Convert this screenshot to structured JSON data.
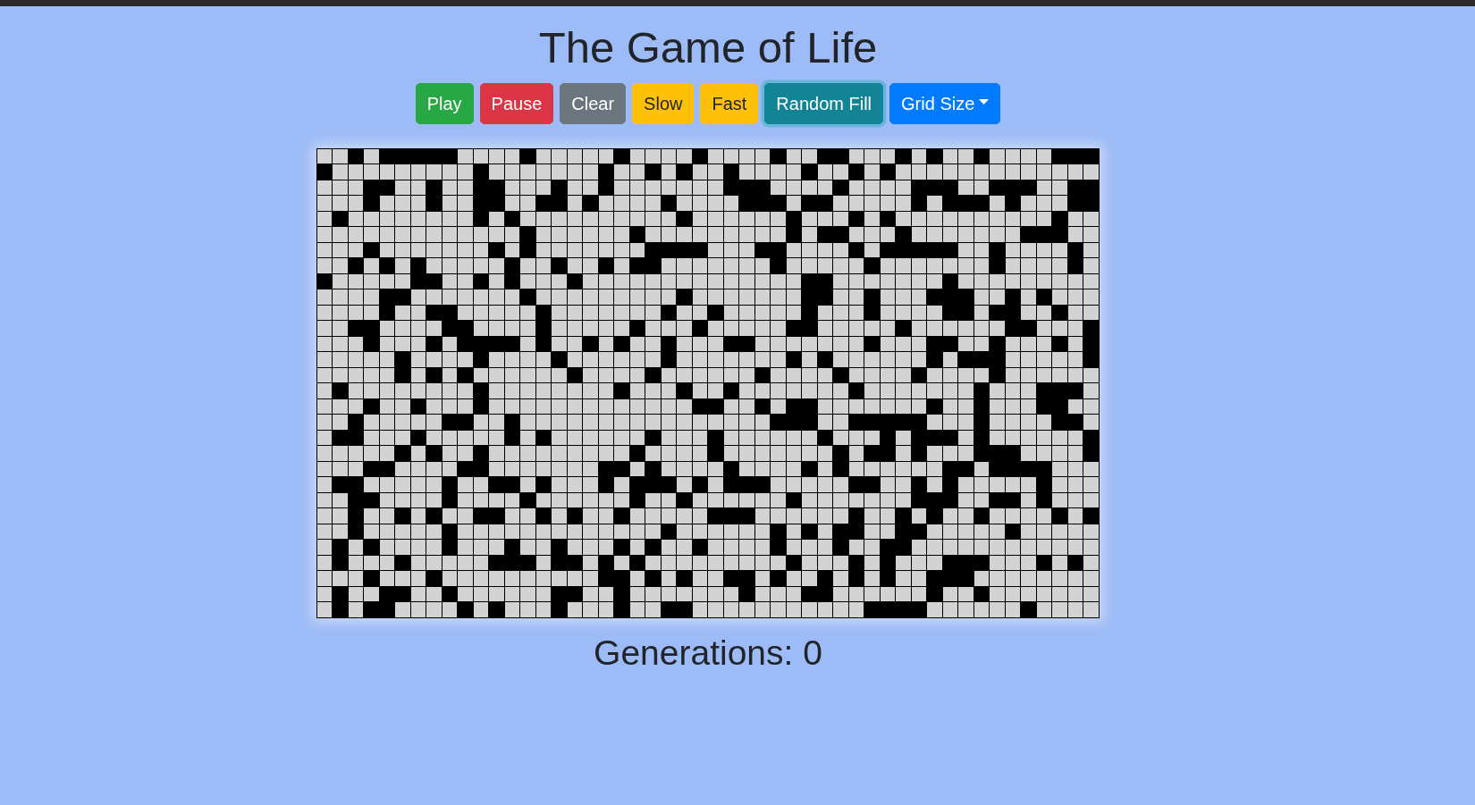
{
  "title": "The Game of Life",
  "buttons": [
    {
      "label": "Play",
      "kind": "button",
      "color": "#28a745",
      "focused": false
    },
    {
      "label": "Pause",
      "kind": "button",
      "color": "#dc3545",
      "focused": false
    },
    {
      "label": "Clear",
      "kind": "button",
      "color": "#6c757d",
      "focused": false
    },
    {
      "label": "Slow",
      "kind": "button",
      "color": "#ffc107",
      "focused": false
    },
    {
      "label": "Fast",
      "kind": "button",
      "color": "#ffc107",
      "focused": false
    },
    {
      "label": "Random Fill",
      "kind": "button",
      "color": "#138496",
      "focused": true
    },
    {
      "label": "Grid Size",
      "kind": "dropdown",
      "color": "#007bff",
      "focused": false
    }
  ],
  "board": {
    "rows": [
      [
        false,
        false,
        true,
        false,
        true,
        true,
        true,
        true,
        true,
        false,
        false,
        false,
        false,
        true,
        false,
        false,
        false,
        false,
        false,
        true,
        false,
        false,
        false,
        false,
        true,
        false,
        false,
        false,
        false,
        true,
        false,
        false,
        true,
        true,
        false,
        false,
        false,
        true,
        false,
        true,
        false,
        false,
        true,
        false,
        false,
        false,
        false,
        true,
        true,
        true
      ],
      [
        true,
        false,
        false,
        false,
        false,
        false,
        false,
        false,
        false,
        false,
        true,
        false,
        false,
        false,
        false,
        false,
        false,
        false,
        true,
        false,
        false,
        true,
        false,
        true,
        false,
        false,
        true,
        false,
        false,
        false,
        false,
        true,
        false,
        false,
        true,
        false,
        true,
        false,
        false,
        false,
        false,
        false,
        false,
        false,
        false,
        false,
        false,
        false,
        false,
        false
      ],
      [
        false,
        false,
        false,
        true,
        true,
        false,
        false,
        true,
        false,
        false,
        true,
        true,
        false,
        false,
        false,
        true,
        false,
        false,
        true,
        false,
        false,
        false,
        false,
        false,
        false,
        false,
        true,
        true,
        true,
        false,
        false,
        false,
        false,
        true,
        false,
        false,
        false,
        false,
        true,
        true,
        true,
        false,
        false,
        true,
        true,
        true,
        false,
        false,
        true,
        true
      ],
      [
        false,
        false,
        false,
        true,
        false,
        false,
        false,
        true,
        false,
        false,
        true,
        true,
        false,
        false,
        true,
        true,
        false,
        true,
        false,
        false,
        false,
        false,
        true,
        false,
        false,
        false,
        false,
        true,
        true,
        true,
        false,
        true,
        true,
        false,
        false,
        false,
        false,
        false,
        true,
        false,
        true,
        true,
        true,
        false,
        true,
        false,
        false,
        false,
        true,
        true
      ],
      [
        false,
        true,
        false,
        false,
        false,
        false,
        false,
        false,
        false,
        false,
        true,
        false,
        true,
        false,
        false,
        false,
        false,
        false,
        false,
        false,
        false,
        false,
        false,
        true,
        false,
        false,
        false,
        false,
        false,
        false,
        true,
        false,
        false,
        false,
        true,
        false,
        true,
        false,
        false,
        false,
        false,
        false,
        false,
        false,
        false,
        false,
        false,
        true,
        false,
        false
      ],
      [
        false,
        false,
        false,
        false,
        false,
        false,
        false,
        false,
        false,
        false,
        false,
        false,
        false,
        true,
        false,
        false,
        false,
        false,
        false,
        false,
        true,
        false,
        false,
        false,
        false,
        false,
        false,
        false,
        false,
        false,
        true,
        false,
        true,
        true,
        false,
        false,
        false,
        true,
        false,
        false,
        false,
        false,
        false,
        false,
        false,
        true,
        true,
        true,
        false,
        false
      ],
      [
        false,
        false,
        false,
        true,
        false,
        false,
        false,
        false,
        false,
        false,
        false,
        true,
        false,
        true,
        false,
        false,
        false,
        false,
        false,
        false,
        false,
        true,
        true,
        true,
        true,
        false,
        false,
        false,
        true,
        true,
        false,
        false,
        false,
        false,
        true,
        false,
        true,
        true,
        true,
        true,
        true,
        false,
        false,
        true,
        false,
        false,
        false,
        false,
        true,
        false
      ],
      [
        false,
        false,
        true,
        false,
        true,
        false,
        true,
        false,
        false,
        false,
        false,
        false,
        true,
        false,
        false,
        true,
        false,
        false,
        true,
        false,
        true,
        true,
        false,
        false,
        false,
        false,
        false,
        false,
        false,
        true,
        false,
        false,
        false,
        false,
        false,
        true,
        false,
        false,
        false,
        false,
        false,
        false,
        false,
        true,
        false,
        false,
        false,
        false,
        true,
        false
      ],
      [
        true,
        false,
        false,
        false,
        false,
        false,
        true,
        true,
        false,
        false,
        true,
        false,
        true,
        false,
        false,
        false,
        true,
        false,
        false,
        false,
        false,
        false,
        false,
        false,
        false,
        false,
        false,
        false,
        false,
        false,
        false,
        true,
        true,
        false,
        false,
        false,
        false,
        false,
        false,
        false,
        true,
        false,
        false,
        false,
        false,
        false,
        false,
        false,
        false,
        false
      ],
      [
        false,
        false,
        false,
        false,
        true,
        true,
        false,
        false,
        false,
        false,
        false,
        false,
        false,
        true,
        false,
        false,
        false,
        false,
        false,
        false,
        false,
        false,
        false,
        true,
        false,
        false,
        false,
        false,
        false,
        false,
        false,
        true,
        true,
        false,
        false,
        true,
        false,
        false,
        false,
        true,
        true,
        true,
        false,
        false,
        true,
        false,
        true,
        false,
        false,
        false
      ],
      [
        false,
        false,
        false,
        false,
        true,
        false,
        false,
        true,
        true,
        false,
        false,
        false,
        false,
        false,
        true,
        false,
        false,
        false,
        false,
        false,
        false,
        false,
        true,
        false,
        false,
        true,
        false,
        false,
        false,
        false,
        false,
        true,
        false,
        false,
        false,
        true,
        false,
        false,
        false,
        false,
        true,
        true,
        false,
        true,
        true,
        false,
        false,
        true,
        false,
        false
      ],
      [
        false,
        false,
        true,
        true,
        false,
        false,
        false,
        false,
        true,
        true,
        false,
        false,
        false,
        false,
        true,
        false,
        false,
        false,
        false,
        false,
        true,
        false,
        false,
        false,
        true,
        false,
        false,
        false,
        false,
        false,
        true,
        true,
        false,
        false,
        false,
        false,
        false,
        true,
        false,
        false,
        false,
        false,
        false,
        false,
        true,
        true,
        false,
        false,
        false,
        true
      ],
      [
        false,
        false,
        false,
        true,
        false,
        false,
        false,
        true,
        false,
        true,
        true,
        true,
        true,
        false,
        true,
        false,
        false,
        true,
        false,
        true,
        false,
        false,
        true,
        false,
        false,
        false,
        true,
        true,
        false,
        false,
        false,
        false,
        false,
        false,
        false,
        true,
        false,
        false,
        false,
        true,
        true,
        false,
        false,
        true,
        false,
        false,
        false,
        true,
        false,
        true
      ],
      [
        false,
        false,
        false,
        false,
        false,
        true,
        false,
        false,
        false,
        false,
        true,
        false,
        false,
        false,
        false,
        true,
        false,
        false,
        false,
        false,
        false,
        false,
        true,
        false,
        false,
        false,
        false,
        false,
        false,
        false,
        true,
        false,
        true,
        false,
        false,
        false,
        false,
        false,
        false,
        true,
        false,
        true,
        true,
        true,
        false,
        false,
        false,
        false,
        false,
        true
      ],
      [
        false,
        false,
        false,
        false,
        false,
        true,
        false,
        true,
        false,
        true,
        false,
        false,
        false,
        false,
        false,
        false,
        true,
        false,
        false,
        false,
        false,
        true,
        false,
        false,
        false,
        false,
        false,
        false,
        true,
        false,
        false,
        false,
        false,
        true,
        false,
        false,
        false,
        false,
        true,
        false,
        false,
        false,
        false,
        true,
        false,
        false,
        false,
        false,
        false,
        false
      ],
      [
        false,
        true,
        false,
        false,
        false,
        false,
        false,
        false,
        false,
        false,
        true,
        false,
        false,
        false,
        false,
        false,
        false,
        false,
        false,
        true,
        false,
        false,
        false,
        true,
        false,
        false,
        true,
        false,
        false,
        false,
        false,
        false,
        false,
        false,
        true,
        false,
        false,
        false,
        false,
        false,
        false,
        false,
        true,
        false,
        false,
        false,
        true,
        true,
        true,
        false
      ],
      [
        false,
        false,
        false,
        true,
        false,
        false,
        true,
        false,
        false,
        false,
        true,
        false,
        false,
        false,
        false,
        false,
        false,
        false,
        false,
        false,
        false,
        false,
        false,
        false,
        true,
        true,
        false,
        false,
        true,
        false,
        true,
        true,
        false,
        false,
        false,
        false,
        false,
        false,
        false,
        true,
        false,
        false,
        true,
        false,
        false,
        false,
        true,
        true,
        false,
        false
      ],
      [
        false,
        false,
        true,
        false,
        false,
        false,
        false,
        false,
        true,
        true,
        false,
        false,
        true,
        false,
        false,
        false,
        false,
        false,
        false,
        false,
        false,
        false,
        false,
        false,
        false,
        false,
        false,
        false,
        false,
        true,
        true,
        true,
        false,
        false,
        true,
        true,
        true,
        true,
        true,
        false,
        false,
        false,
        true,
        false,
        false,
        false,
        false,
        true,
        true,
        false
      ],
      [
        false,
        true,
        true,
        false,
        false,
        false,
        true,
        false,
        false,
        false,
        false,
        false,
        true,
        false,
        true,
        false,
        false,
        false,
        false,
        false,
        false,
        true,
        false,
        false,
        false,
        true,
        false,
        false,
        false,
        false,
        false,
        false,
        true,
        false,
        false,
        false,
        true,
        false,
        true,
        true,
        true,
        false,
        true,
        false,
        false,
        false,
        false,
        false,
        false,
        true
      ],
      [
        false,
        false,
        false,
        false,
        false,
        true,
        false,
        true,
        false,
        false,
        true,
        false,
        false,
        false,
        false,
        false,
        false,
        false,
        false,
        false,
        true,
        false,
        false,
        false,
        false,
        true,
        false,
        false,
        false,
        false,
        false,
        false,
        false,
        true,
        false,
        true,
        true,
        false,
        true,
        false,
        false,
        false,
        true,
        true,
        true,
        false,
        false,
        false,
        false,
        true
      ],
      [
        false,
        false,
        false,
        true,
        true,
        false,
        false,
        false,
        false,
        true,
        true,
        false,
        false,
        false,
        false,
        false,
        false,
        false,
        true,
        true,
        false,
        true,
        false,
        false,
        false,
        false,
        true,
        false,
        false,
        false,
        false,
        true,
        false,
        true,
        false,
        false,
        false,
        false,
        false,
        false,
        true,
        true,
        false,
        true,
        true,
        true,
        true,
        false,
        false,
        false
      ],
      [
        false,
        true,
        true,
        false,
        false,
        false,
        false,
        false,
        true,
        false,
        false,
        true,
        true,
        false,
        true,
        false,
        false,
        false,
        true,
        false,
        true,
        true,
        true,
        false,
        true,
        false,
        true,
        true,
        true,
        false,
        false,
        false,
        false,
        false,
        true,
        true,
        false,
        false,
        true,
        false,
        true,
        false,
        false,
        false,
        false,
        false,
        true,
        false,
        false,
        false
      ],
      [
        false,
        false,
        true,
        true,
        false,
        false,
        false,
        false,
        true,
        false,
        false,
        false,
        false,
        true,
        false,
        false,
        false,
        false,
        false,
        false,
        true,
        false,
        false,
        true,
        false,
        false,
        false,
        false,
        false,
        false,
        true,
        false,
        false,
        false,
        false,
        false,
        false,
        false,
        true,
        true,
        true,
        false,
        false,
        true,
        true,
        false,
        true,
        false,
        false,
        false
      ],
      [
        false,
        false,
        true,
        false,
        false,
        true,
        false,
        true,
        false,
        false,
        true,
        true,
        false,
        false,
        true,
        false,
        true,
        false,
        false,
        true,
        false,
        false,
        false,
        false,
        false,
        true,
        true,
        true,
        false,
        false,
        false,
        false,
        false,
        false,
        true,
        false,
        false,
        true,
        false,
        true,
        false,
        false,
        true,
        false,
        false,
        false,
        false,
        true,
        false,
        true
      ],
      [
        false,
        false,
        true,
        false,
        false,
        false,
        false,
        false,
        true,
        false,
        false,
        false,
        false,
        false,
        false,
        false,
        false,
        false,
        false,
        false,
        false,
        false,
        true,
        false,
        false,
        false,
        false,
        false,
        false,
        true,
        false,
        true,
        false,
        true,
        true,
        false,
        false,
        true,
        true,
        false,
        false,
        false,
        false,
        false,
        true,
        false,
        false,
        false,
        false,
        false
      ],
      [
        false,
        true,
        false,
        true,
        false,
        false,
        false,
        false,
        true,
        false,
        false,
        false,
        true,
        false,
        false,
        true,
        false,
        false,
        false,
        true,
        false,
        true,
        false,
        false,
        true,
        false,
        false,
        false,
        false,
        true,
        false,
        false,
        false,
        true,
        false,
        false,
        true,
        true,
        false,
        false,
        false,
        false,
        false,
        false,
        false,
        false,
        false,
        false,
        false,
        false
      ],
      [
        false,
        true,
        false,
        false,
        false,
        true,
        false,
        false,
        false,
        false,
        false,
        true,
        true,
        true,
        false,
        true,
        true,
        false,
        true,
        false,
        true,
        false,
        false,
        false,
        false,
        false,
        false,
        false,
        false,
        false,
        true,
        false,
        false,
        false,
        true,
        false,
        true,
        false,
        false,
        false,
        true,
        true,
        true,
        false,
        false,
        false,
        true,
        false,
        true,
        false
      ],
      [
        false,
        false,
        false,
        true,
        false,
        false,
        false,
        true,
        false,
        false,
        false,
        false,
        false,
        false,
        false,
        false,
        false,
        false,
        true,
        true,
        false,
        true,
        false,
        true,
        false,
        false,
        true,
        true,
        false,
        true,
        false,
        false,
        true,
        false,
        true,
        false,
        true,
        false,
        false,
        true,
        true,
        true,
        false,
        false,
        false,
        false,
        false,
        false,
        false,
        false
      ],
      [
        false,
        true,
        false,
        false,
        true,
        true,
        false,
        false,
        true,
        false,
        false,
        false,
        false,
        false,
        false,
        true,
        true,
        false,
        false,
        true,
        false,
        false,
        false,
        false,
        false,
        false,
        false,
        true,
        false,
        false,
        false,
        true,
        true,
        false,
        false,
        false,
        false,
        false,
        false,
        true,
        false,
        false,
        true,
        false,
        false,
        false,
        false,
        false,
        false,
        false
      ],
      [
        false,
        true,
        false,
        true,
        true,
        false,
        false,
        false,
        false,
        true,
        false,
        true,
        false,
        false,
        false,
        true,
        false,
        false,
        false,
        true,
        false,
        false,
        true,
        true,
        false,
        false,
        false,
        false,
        false,
        false,
        false,
        false,
        false,
        false,
        false,
        true,
        true,
        true,
        true,
        false,
        false,
        false,
        false,
        false,
        false,
        true,
        false,
        false,
        false,
        false
      ]
    ]
  },
  "generations": "Generations: 0"
}
